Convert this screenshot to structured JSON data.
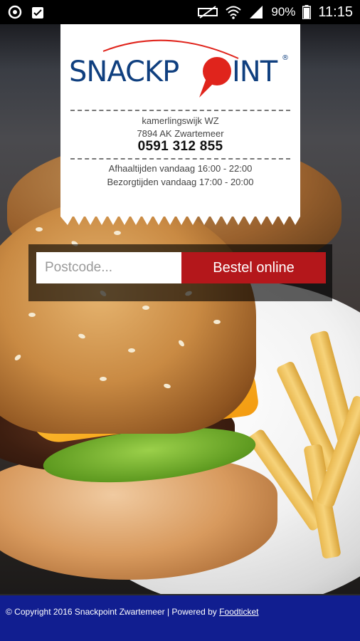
{
  "statusbar": {
    "left_icons": [
      "sync-icon",
      "clipboard-check-icon"
    ],
    "right_icons": [
      "mute-icon",
      "wifi-icon",
      "signal-icon",
      "battery-icon"
    ],
    "battery": "90%",
    "time": "11:15"
  },
  "brand": {
    "name": "SNACKPOINT",
    "name_before_dot": "SNACKP",
    "name_after_dot": "INT",
    "registered": "®",
    "primary_color": "#0f3f7f",
    "accent_color": "#e0241c"
  },
  "receipt": {
    "address_line": "kamerlingswijk WZ",
    "postal_city": "7894 AK Zwartemeer",
    "phone": "0591 312 855",
    "pickup_hours": "Afhaaltijden vandaag 16:00 - 22:00",
    "delivery_hours": "Bezorgtijden vandaag 17:00 - 20:00"
  },
  "order": {
    "postcode_placeholder": "Postcode...",
    "postcode_value": "",
    "button_label": "Bestel online",
    "button_color": "#b4171b"
  },
  "footer": {
    "copyright": "© Copyright 2016 Snackpoint Zwartemeer | Powered by ",
    "link_label": "Foodticket",
    "background_color": "#111e90"
  }
}
